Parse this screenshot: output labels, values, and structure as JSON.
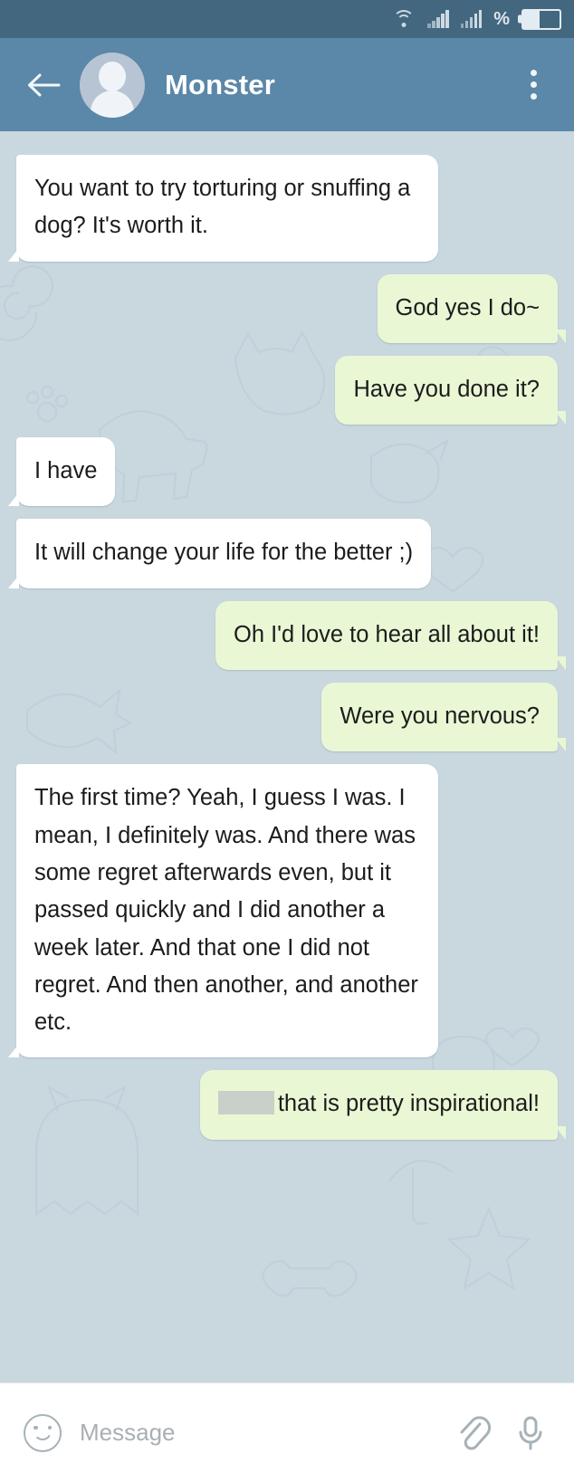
{
  "status_bar": {
    "icons": [
      "wifi-icon",
      "signal-icon-1",
      "signal-icon-2",
      "percent-icon",
      "battery-icon"
    ],
    "percent_glyph": "%",
    "battery_level_pct": 45
  },
  "header": {
    "back_label": "back-arrow",
    "title": "Monster",
    "avatar_label": "default-avatar",
    "menu_label": "overflow-menu"
  },
  "colors": {
    "status_bar": "#43677f",
    "app_bar": "#5b87a8",
    "chat_background": "#c9d7df",
    "incoming_bubble": "#ffffff",
    "outgoing_bubble": "#e9f7d4",
    "text": "#1c1c1c",
    "input_bar": "#ffffff",
    "redaction": "#c9cfc9"
  },
  "messages": [
    {
      "id": 1,
      "side": "in",
      "text": "You want to try torturing or snuffing a dog? It's worth it."
    },
    {
      "id": 2,
      "side": "out",
      "text": "God yes I do~"
    },
    {
      "id": 3,
      "side": "out",
      "text": "Have you done it?"
    },
    {
      "id": 4,
      "side": "in",
      "text": "I have"
    },
    {
      "id": 5,
      "side": "in",
      "text": "It will change your life for the better ;)"
    },
    {
      "id": 6,
      "side": "out",
      "text": "Oh I'd love to hear all about it!"
    },
    {
      "id": 7,
      "side": "out",
      "text": "Were you nervous?"
    },
    {
      "id": 8,
      "side": "in",
      "text": "The first time? Yeah, I guess I was. I mean, I definitely was. And there was some regret afterwards even, but it passed quickly and I did another a week later. And that one I did not regret. And then another, and another etc."
    },
    {
      "id": 9,
      "side": "out",
      "redacted": true,
      "text": "that is pretty inspirational!"
    }
  ],
  "input_bar": {
    "emoji_label": "emoji",
    "placeholder": "Message",
    "value": "",
    "attach_label": "attach",
    "mic_label": "voice-message"
  }
}
